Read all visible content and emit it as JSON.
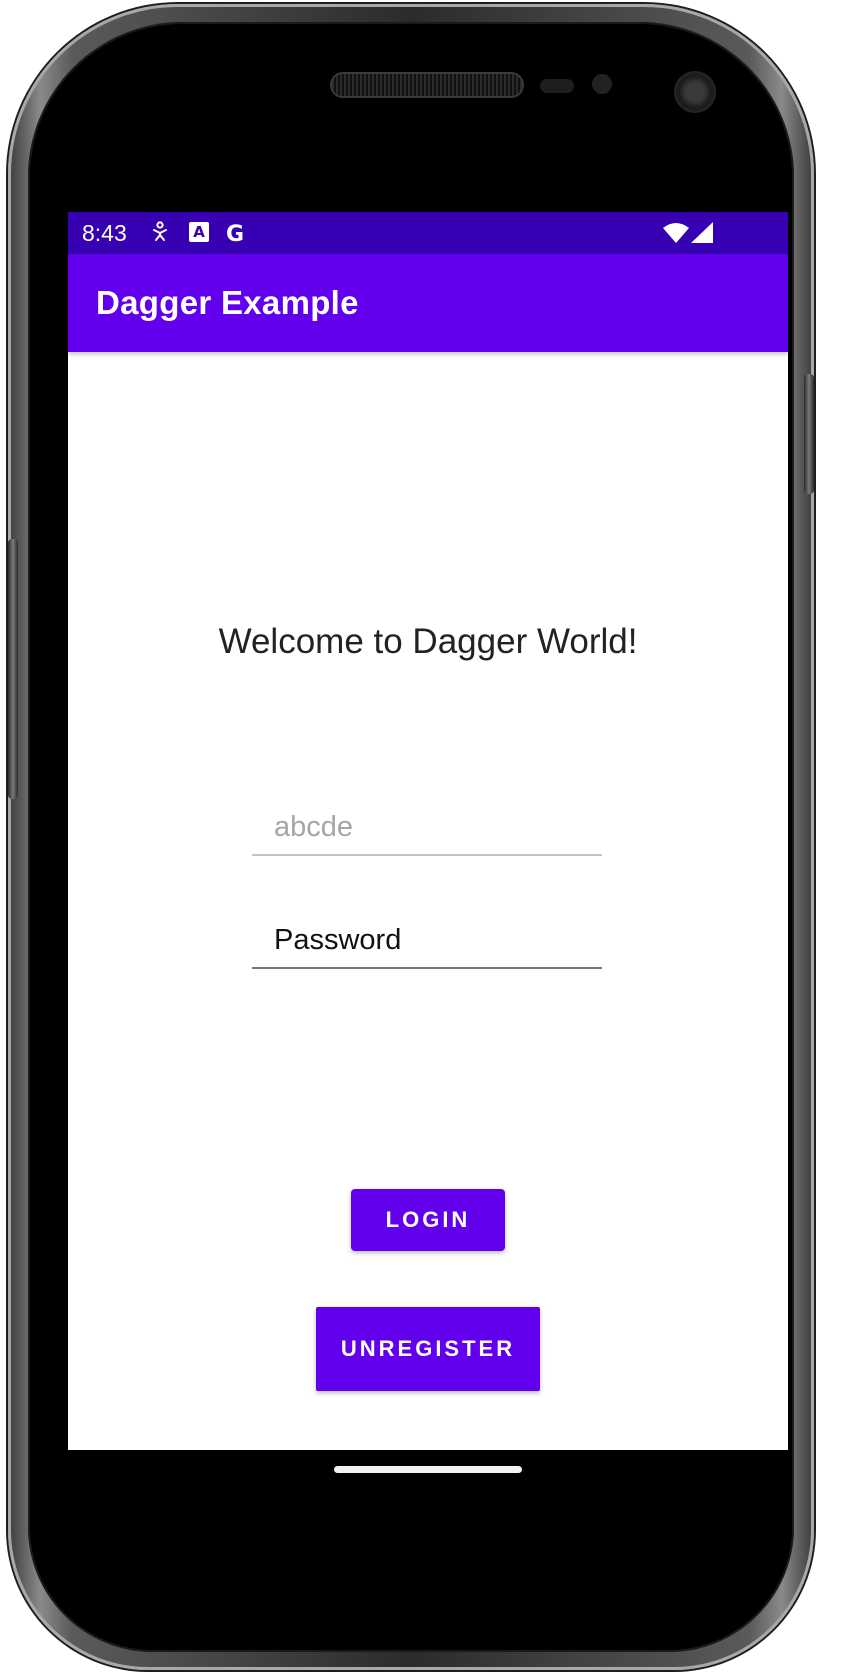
{
  "status_bar": {
    "time": "8:43",
    "notification_icons": [
      "accessibility-icon",
      "text-badge-icon",
      "google-icon"
    ],
    "system_icons": [
      "wifi-icon",
      "cell-signal-icon"
    ],
    "text_badge_glyph": "A",
    "google_glyph": "G"
  },
  "app_bar": {
    "title": "Dagger Example"
  },
  "login": {
    "welcome": "Welcome to Dagger World!",
    "username_placeholder": "abcde",
    "password_value": "Password",
    "login_label": "LOGIN",
    "unregister_label": "UNREGISTER"
  },
  "colors": {
    "status_bar": "#3700b3",
    "primary": "#6200ee",
    "on_primary": "#ffffff",
    "background": "#ffffff"
  }
}
